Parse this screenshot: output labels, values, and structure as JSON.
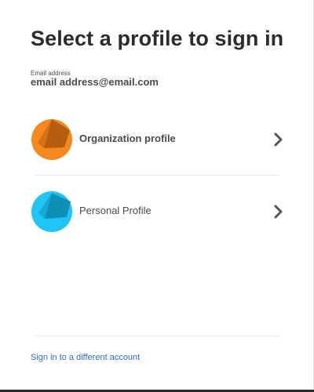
{
  "title": "Select a profile to sign in",
  "email": {
    "label": "Email address",
    "value": "email address@email.com"
  },
  "profiles": [
    {
      "label": "Organization profile",
      "icon": "organization-avatar-icon",
      "color": "#f5891e",
      "shade_color": "#b55e10"
    },
    {
      "label": "Personal Profile",
      "icon": "personal-avatar-icon",
      "color": "#1fc6f5",
      "shade_color": "#0f8fb6"
    }
  ],
  "footer": {
    "link_label": "Sign in to a different account",
    "link_color": "#2d6bd6"
  }
}
